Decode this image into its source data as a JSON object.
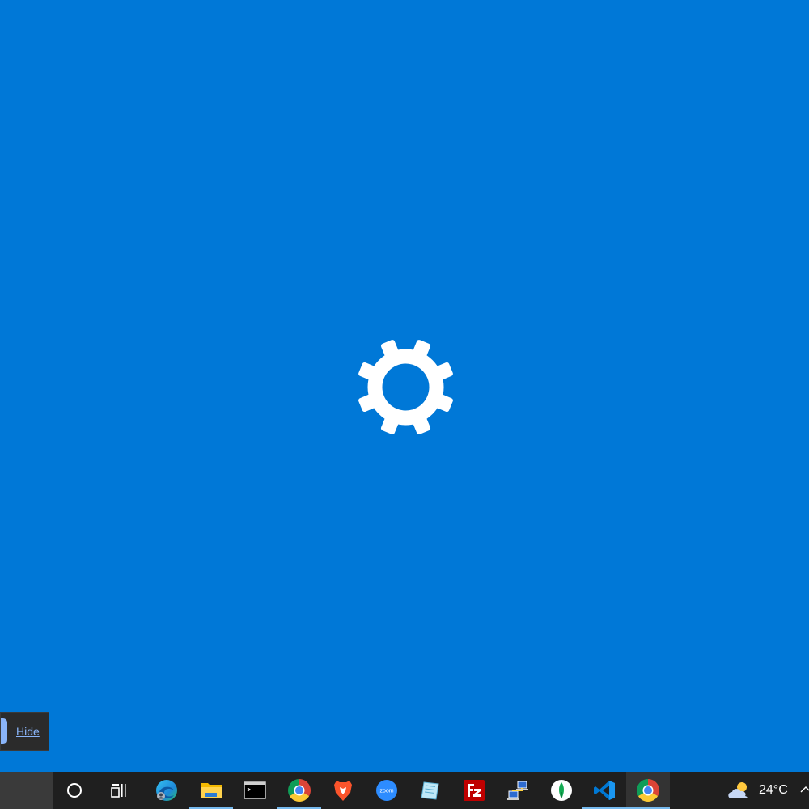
{
  "colors": {
    "splash_background": "#0078d7",
    "taskbar_background": "#1f1f1f",
    "active_indicator": "#76b9ed",
    "notification_accent": "#8ab4f8"
  },
  "splash": {
    "icon": "gear-icon"
  },
  "notification": {
    "hide_label": "Hide"
  },
  "taskbar": {
    "items": [
      {
        "icon": "cortana-icon",
        "open": false
      },
      {
        "icon": "task-view-icon",
        "open": false
      },
      {
        "icon": "edge-icon",
        "open": false
      },
      {
        "icon": "file-explorer-icon",
        "open": true
      },
      {
        "icon": "terminal-icon",
        "open": false
      },
      {
        "icon": "chrome-icon",
        "open": true
      },
      {
        "icon": "brave-icon",
        "open": false
      },
      {
        "icon": "zoom-icon",
        "open": false,
        "label": "zoom"
      },
      {
        "icon": "notepad-icon",
        "open": false
      },
      {
        "icon": "filezilla-icon",
        "open": false
      },
      {
        "icon": "network-icon",
        "open": false
      },
      {
        "icon": "mongodb-compass-icon",
        "open": false
      },
      {
        "icon": "vscode-icon",
        "open": true
      },
      {
        "icon": "chrome-icon",
        "open": true,
        "active": true
      }
    ],
    "weather": {
      "icon": "partly-cloudy-icon",
      "temperature": "24°C"
    },
    "tray": {
      "icon": "chevron-up-icon"
    }
  }
}
